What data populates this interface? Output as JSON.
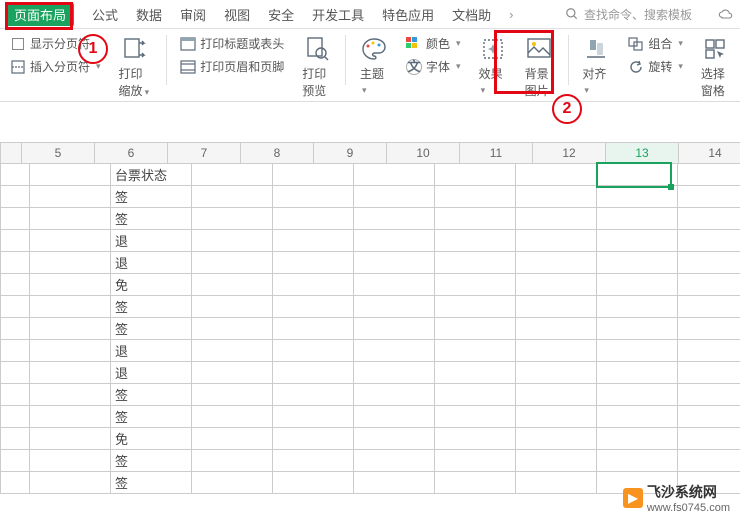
{
  "menubar": {
    "tabs": [
      "页面布局",
      "公式",
      "数据",
      "审阅",
      "视图",
      "安全",
      "开发工具",
      "特色应用",
      "文档助"
    ],
    "active_index": 0,
    "search_placeholder": "查找命令、搜索模板"
  },
  "ribbon": {
    "show_page_break": "显示分页符",
    "insert_page_break": "插入分页符",
    "print_scaling": "打印缩放",
    "print_title": "打印标题或表头",
    "print_header_footer": "打印页眉和页脚",
    "print_preview": "打印预览",
    "theme": "主题",
    "color": "颜色",
    "font": "字体",
    "effect": "效果",
    "background_image": "背景图片",
    "align": "对齐",
    "group": "组合",
    "rotate": "旋转",
    "selection_pane": "选择窗格"
  },
  "callouts": {
    "one": "1",
    "two": "2"
  },
  "sheet": {
    "columns": [
      "5",
      "6",
      "7",
      "8",
      "9",
      "10",
      "11",
      "12",
      "13",
      "14"
    ],
    "active_col_index": 8,
    "rows": [
      [
        "",
        "台票状态",
        "",
        "",
        "",
        "",
        "",
        "",
        "",
        ""
      ],
      [
        "",
        "签",
        "",
        "",
        "",
        "",
        "",
        "",
        "",
        ""
      ],
      [
        "",
        "签",
        "",
        "",
        "",
        "",
        "",
        "",
        "",
        ""
      ],
      [
        "",
        "退",
        "",
        "",
        "",
        "",
        "",
        "",
        "",
        ""
      ],
      [
        "",
        "退",
        "",
        "",
        "",
        "",
        "",
        "",
        "",
        ""
      ],
      [
        "",
        "免",
        "",
        "",
        "",
        "",
        "",
        "",
        "",
        ""
      ],
      [
        "",
        "签",
        "",
        "",
        "",
        "",
        "",
        "",
        "",
        ""
      ],
      [
        "",
        "签",
        "",
        "",
        "",
        "",
        "",
        "",
        "",
        ""
      ],
      [
        "",
        "退",
        "",
        "",
        "",
        "",
        "",
        "",
        "",
        ""
      ],
      [
        "",
        "退",
        "",
        "",
        "",
        "",
        "",
        "",
        "",
        ""
      ],
      [
        "",
        "签",
        "",
        "",
        "",
        "",
        "",
        "",
        "",
        ""
      ],
      [
        "",
        "签",
        "",
        "",
        "",
        "",
        "",
        "",
        "",
        ""
      ],
      [
        "",
        "免",
        "",
        "",
        "",
        "",
        "",
        "",
        "",
        ""
      ],
      [
        "",
        "签",
        "",
        "",
        "",
        "",
        "",
        "",
        "",
        ""
      ],
      [
        "",
        "签",
        "",
        "",
        "",
        "",
        "",
        "",
        "",
        ""
      ]
    ]
  },
  "watermark": {
    "brand": "飞沙系统网",
    "url": "www.fs0745.com"
  }
}
